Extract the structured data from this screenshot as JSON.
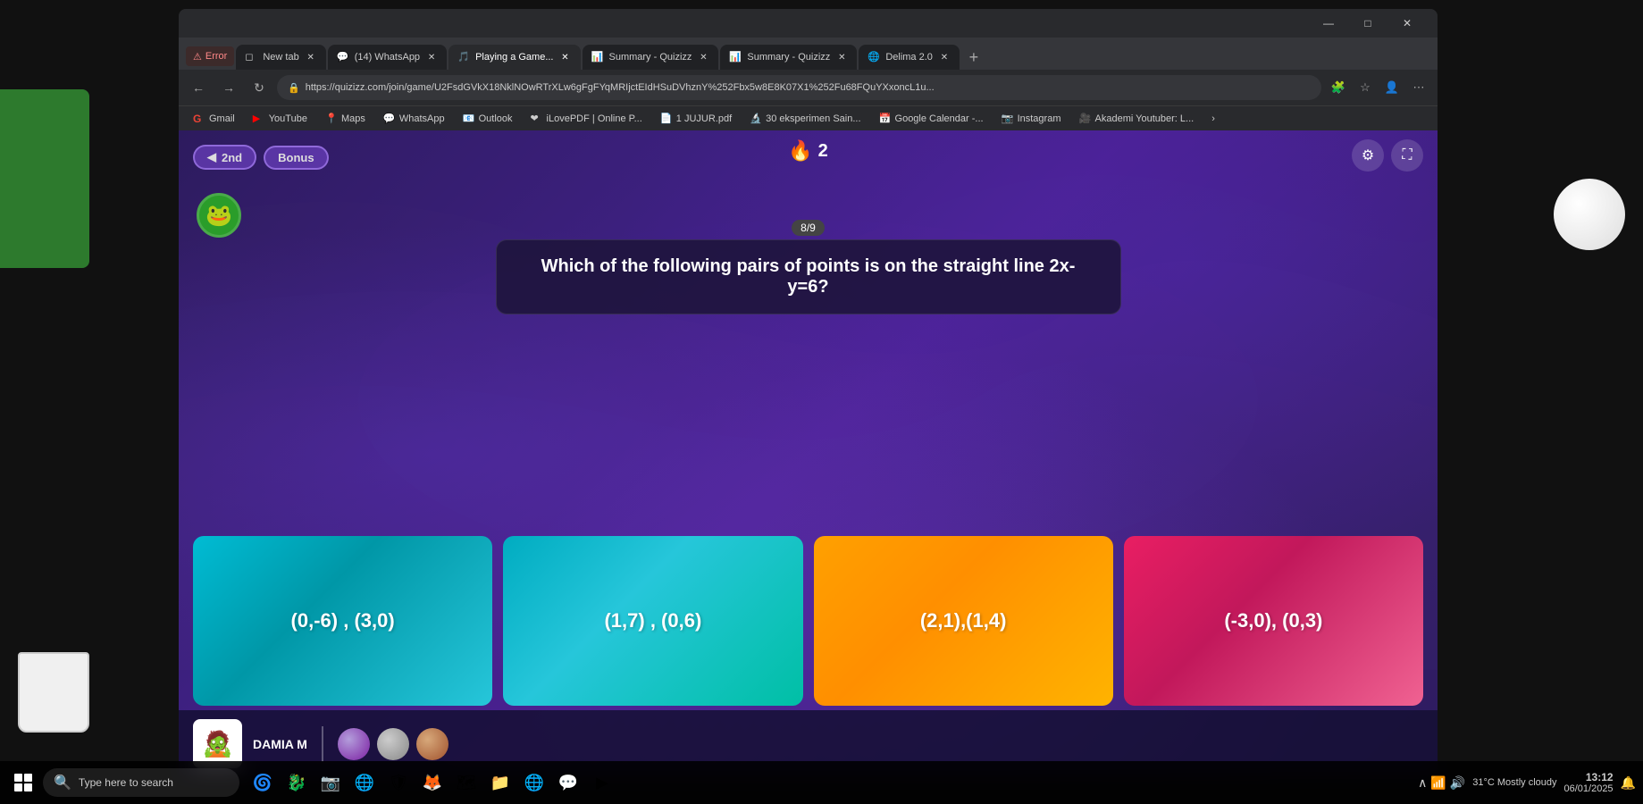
{
  "browser": {
    "tabs": [
      {
        "id": "error-tab",
        "label": "Error",
        "icon": "⚠",
        "active": false,
        "error": true
      },
      {
        "id": "new-tab",
        "label": "New tab",
        "icon": "◻",
        "active": false
      },
      {
        "id": "whatsapp-tab",
        "label": "(14) WhatsApp",
        "icon": "💬",
        "active": false
      },
      {
        "id": "game-tab",
        "label": "Playing a Game...",
        "icon": "🎵",
        "active": true
      },
      {
        "id": "quizizz1-tab",
        "label": "Summary - Quizizz",
        "icon": "📊",
        "active": false
      },
      {
        "id": "quizizz2-tab",
        "label": "Summary - Quizizz",
        "icon": "📊",
        "active": false
      },
      {
        "id": "delima-tab",
        "label": "Delima 2.0",
        "icon": "🌐",
        "active": false
      }
    ],
    "address": "https://quizizz.com/join/game/U2FsdGVkX18NklNOwRTrXLw6gFgFYqMRIjctEIdHSuDVhznY%252Fbx5w8E8K07X1%252Fu68FQuYXxoncL1u...",
    "bookmarks": [
      {
        "label": "Gmail",
        "icon": "G"
      },
      {
        "label": "YouTube",
        "icon": "▶"
      },
      {
        "label": "Maps",
        "icon": "📍"
      },
      {
        "label": "WhatsApp",
        "icon": "💬"
      },
      {
        "label": "Outlook",
        "icon": "📧"
      },
      {
        "label": "iLovePDF | Online P...",
        "icon": "❤"
      },
      {
        "label": "1 JUJUR.pdf",
        "icon": "📄"
      },
      {
        "label": "30 eksperimen Sain...",
        "icon": "🔬"
      },
      {
        "label": "Google Calendar -...",
        "icon": "📅"
      },
      {
        "label": "Instagram",
        "icon": "📷"
      },
      {
        "label": "Akademi Youtuber: L...",
        "icon": "🎥"
      }
    ]
  },
  "game": {
    "badge_2nd": "2nd",
    "badge_bonus": "Bonus",
    "score": "2",
    "score_icon": "🔥",
    "question_number": "8/9",
    "question_text": "Which of the following pairs of points is on the straight line 2x-y=6?",
    "answers": [
      {
        "id": "a",
        "text": "(0,-6) , (3,0)",
        "color_class": "answer-card-a"
      },
      {
        "id": "b",
        "text": "(1,7) , (0,6)",
        "color_class": "answer-card-b"
      },
      {
        "id": "c",
        "text": "(2,1),(1,4)",
        "color_class": "answer-card-c"
      },
      {
        "id": "d",
        "text": "(-3,0), (0,3)",
        "color_class": "answer-card-d"
      }
    ],
    "player": {
      "name": "DAMIA M",
      "character": "🧟",
      "orbs": [
        "purple",
        "gray",
        "brown"
      ]
    },
    "settings_icon": "⚙",
    "fullscreen_icon": "⛶"
  },
  "taskbar": {
    "search_placeholder": "Type here to search",
    "weather": "31°C  Mostly cloudy",
    "time": "13:12",
    "date": "06/01/2025",
    "icons": [
      "🌀",
      "🐉",
      "📷",
      "🌐",
      "🛡",
      "🦊",
      "🗺",
      "📁",
      "🌐",
      "💬",
      "▶"
    ]
  },
  "window": {
    "title": "",
    "controls": [
      "—",
      "□",
      "✕"
    ]
  }
}
